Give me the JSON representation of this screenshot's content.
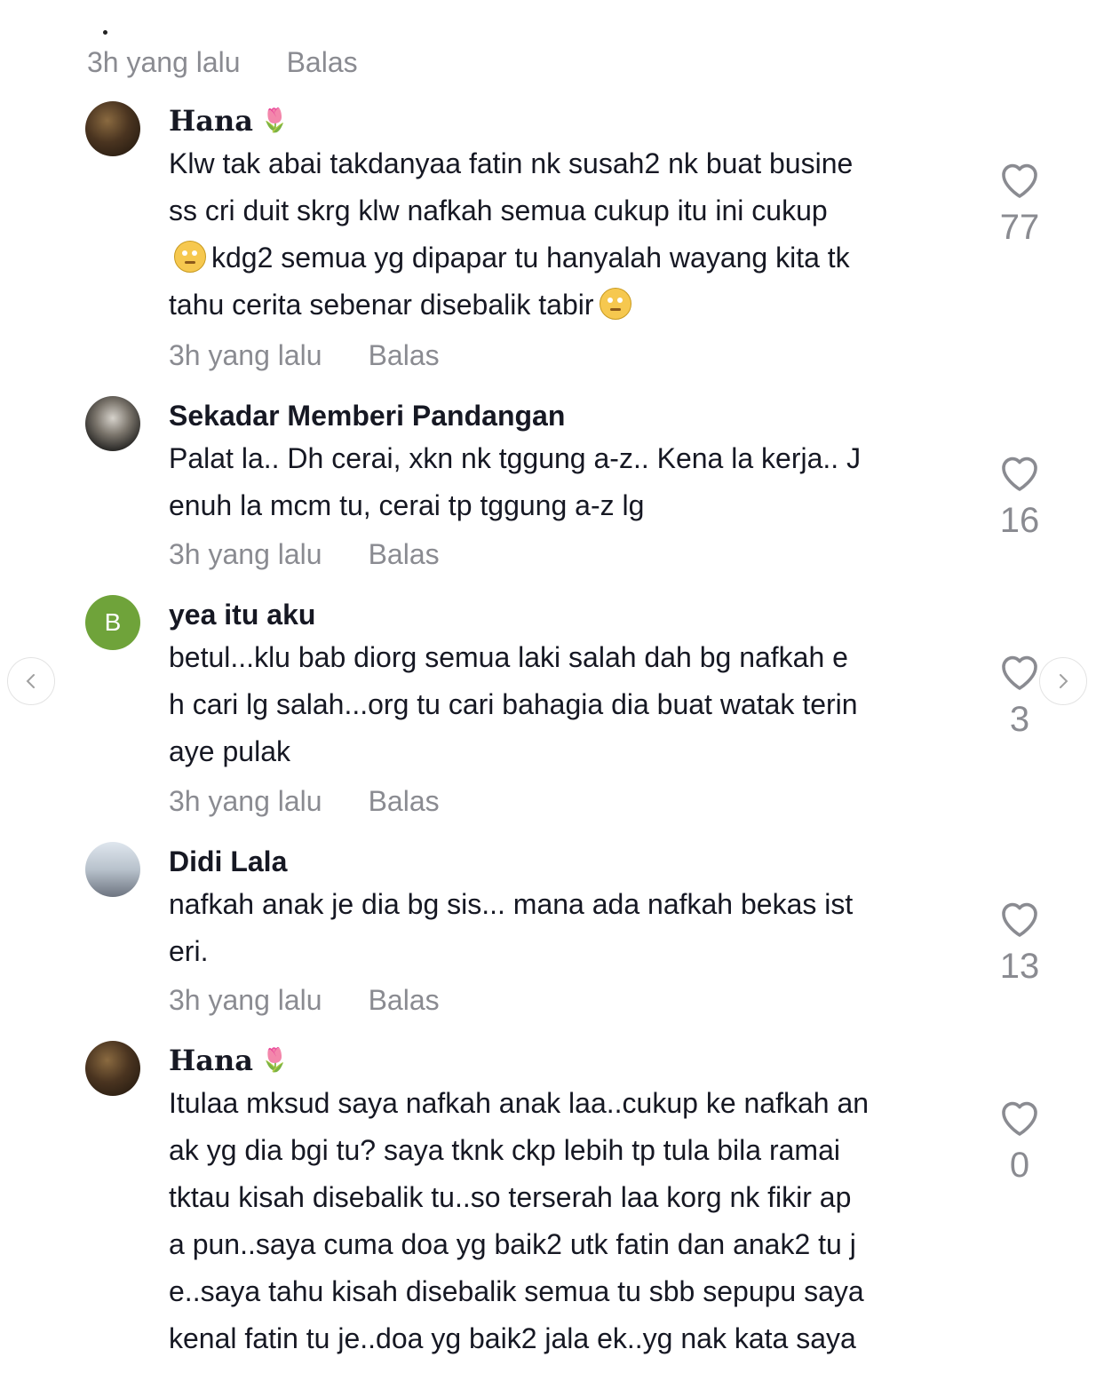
{
  "top_meta": {
    "time": "3h yang lalu",
    "reply": "Balas"
  },
  "comments": [
    {
      "name": "Hana",
      "lines": [
        "Klw tak abai takdanyaa fatin nk susah2 nk buat busine",
        "ss cri duit skrg klw nafkah semua cukup itu ini cukup",
        "kdg2 semua yg dipapar tu hanyalah wayang kita tk",
        "tahu cerita sebenar disebalik tabir"
      ],
      "time": "3h yang lalu",
      "reply": "Balas",
      "likes": "77"
    },
    {
      "name": "Sekadar Memberi Pandangan",
      "lines": [
        "Palat la.. Dh cerai, xkn nk tggung a-z.. Kena la kerja.. J",
        "enuh la mcm tu, cerai tp tggung a-z lg"
      ],
      "time": "3h yang lalu",
      "reply": "Balas",
      "likes": "16"
    },
    {
      "name": "yea itu aku",
      "avatar_letter": "B",
      "lines": [
        "betul...klu bab diorg semua laki salah dah bg nafkah e",
        "h cari lg salah...org tu cari bahagia dia buat watak terin",
        "aye pulak"
      ],
      "time": "3h yang lalu",
      "reply": "Balas",
      "likes": "3"
    },
    {
      "name": "Didi Lala",
      "lines": [
        "nafkah anak je dia bg sis... mana ada nafkah bekas ist",
        "eri."
      ],
      "time": "3h yang lalu",
      "reply": "Balas",
      "likes": "13"
    },
    {
      "name": "Hana",
      "lines": [
        "Itulaa mksud saya nafkah anak laa..cukup ke nafkah an",
        "ak yg dia bgi tu? saya tknk ckp lebih tp tula bila ramai",
        "tktau kisah disebalik tu..so terserah laa korg nk fikir ap",
        "a pun..saya cuma doa yg baik2 utk fatin dan anak2 tu j",
        "e..saya tahu kisah disebalik semua tu sbb sepupu saya",
        "kenal fatin tu je..doa yg baik2 jala ek..yg nak kata saya"
      ],
      "likes": "0"
    }
  ],
  "icons": {
    "tulip": "tulip-emoji",
    "eyeroll": "eye-roll-emoji",
    "like": "heart-icon",
    "prev": "chevron-left-icon",
    "next": "chevron-right-icon"
  },
  "colors": {
    "meta": "#8a8b91",
    "text": "#161823",
    "avatar_b": "#6fa33a"
  }
}
